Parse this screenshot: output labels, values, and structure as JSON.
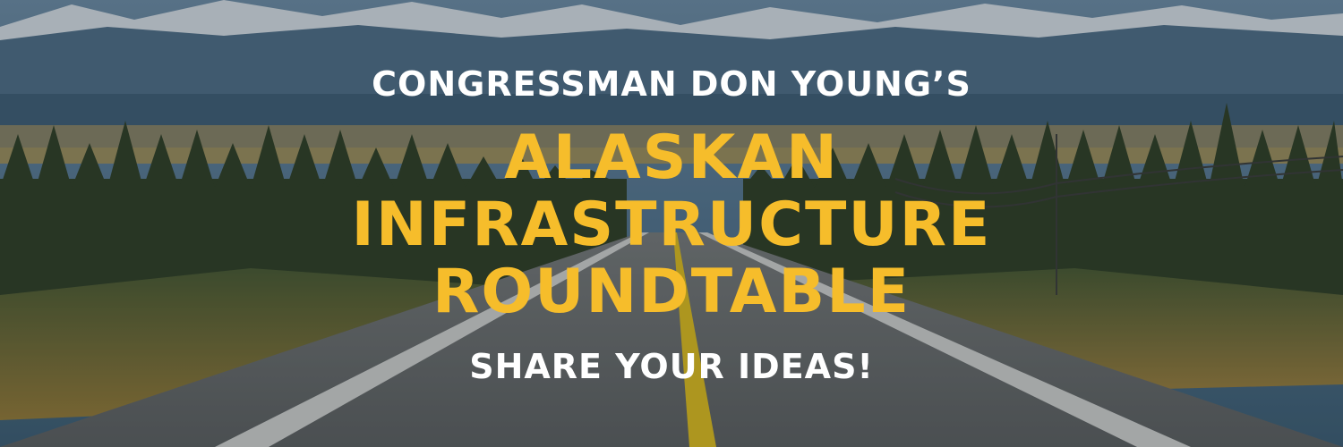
{
  "banner": {
    "pretitle": "Congressman Don Young’s",
    "title_lines": [
      "Alaskan",
      "Infrastructure",
      "Roundtable"
    ],
    "subtitle": "Share your ideas!"
  },
  "colors": {
    "title": "#f6bd2b",
    "text": "#ffffff",
    "sky": "#5a7e9a",
    "forest": "#2f3f23",
    "road": "#6b6d6c",
    "road_line": "#e6c21a"
  }
}
